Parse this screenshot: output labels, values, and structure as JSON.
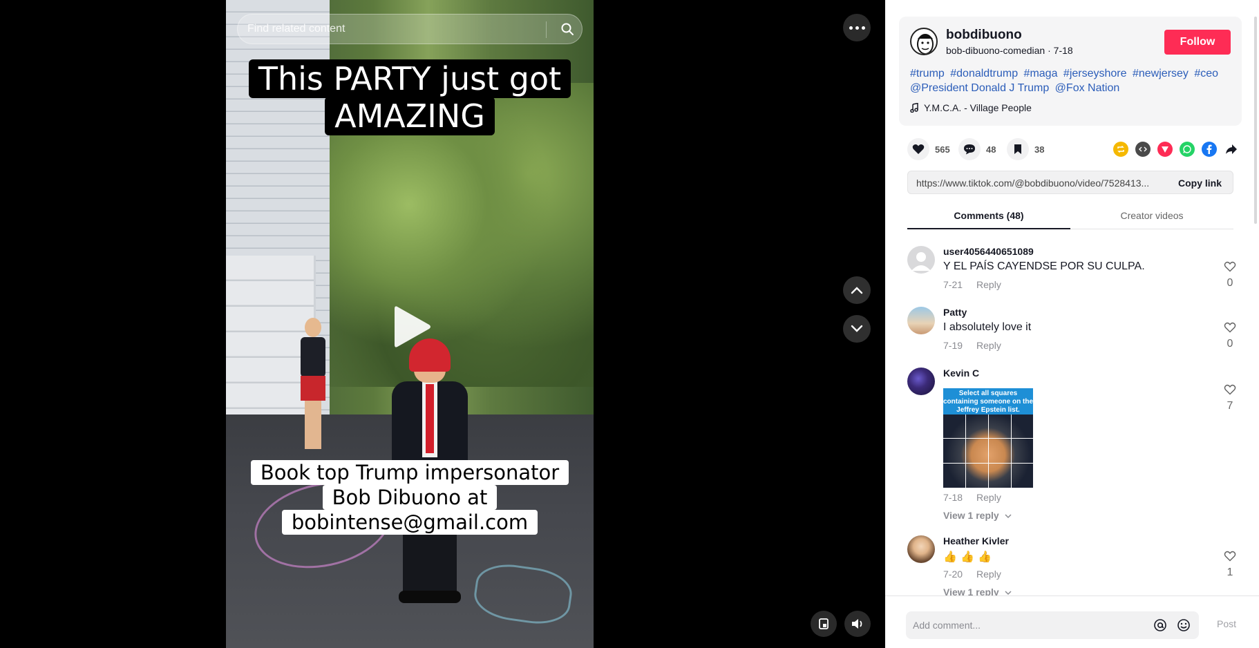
{
  "video": {
    "search_placeholder": "Find related content",
    "caption_top": [
      "This PARTY just got",
      "AMAZING"
    ],
    "caption_bottom": [
      "Book top Trump impersonator",
      "Bob Dibuono at",
      "bobintense@gmail.com"
    ]
  },
  "author": {
    "name": "bobdibuono",
    "subtitle": "bob-dibuono-comedian · 7-18",
    "follow_label": "Follow"
  },
  "description": {
    "tags": [
      "#trump",
      "#donaldtrump",
      "#maga",
      "#jerseyshore",
      "#newjersey",
      "#ceo",
      "@President Donald J Trump",
      "@Fox Nation"
    ],
    "music": "Y.M.C.A. - Village People"
  },
  "stats": {
    "likes": "565",
    "comments": "48",
    "saves": "38"
  },
  "share_icons": [
    {
      "name": "repost-icon",
      "color": "#f5b800"
    },
    {
      "name": "embed-icon",
      "color": "#4a4a4a"
    },
    {
      "name": "send-icon",
      "color": "#fe2c55"
    },
    {
      "name": "whatsapp-icon",
      "color": "#25d366"
    },
    {
      "name": "facebook-icon",
      "color": "#1877f2"
    },
    {
      "name": "share-arrow-icon",
      "color": "#161823"
    }
  ],
  "link": {
    "url": "https://www.tiktok.com/@bobdibuono/video/7528413...",
    "copy_label": "Copy link"
  },
  "tabs": {
    "comments": "Comments (48)",
    "creator": "Creator videos"
  },
  "comments": [
    {
      "user": "user4056440651089",
      "text": "Y EL PAÍS CAYENDSE POR SU CULPA.",
      "date": "7-21",
      "reply": "Reply",
      "likes": "0"
    },
    {
      "user": "Patty",
      "text": "I absolutely love it",
      "date": "7-19",
      "reply": "Reply",
      "likes": "0"
    },
    {
      "user": "Kevin C",
      "image_text": "Select all squares containing someone on the Jeffrey Epstein list.",
      "date": "7-18",
      "reply": "Reply",
      "likes": "7",
      "view_replies": "View 1 reply"
    },
    {
      "user": "Heather Kivler",
      "text": "👍 👍 👍",
      "date": "7-20",
      "reply": "Reply",
      "likes": "1",
      "view_replies": "View 1 reply"
    }
  ],
  "comment_bar": {
    "placeholder": "Add comment...",
    "post_label": "Post"
  },
  "colors": {
    "accent": "#fe2c55",
    "hashtag": "#2b5db9"
  }
}
